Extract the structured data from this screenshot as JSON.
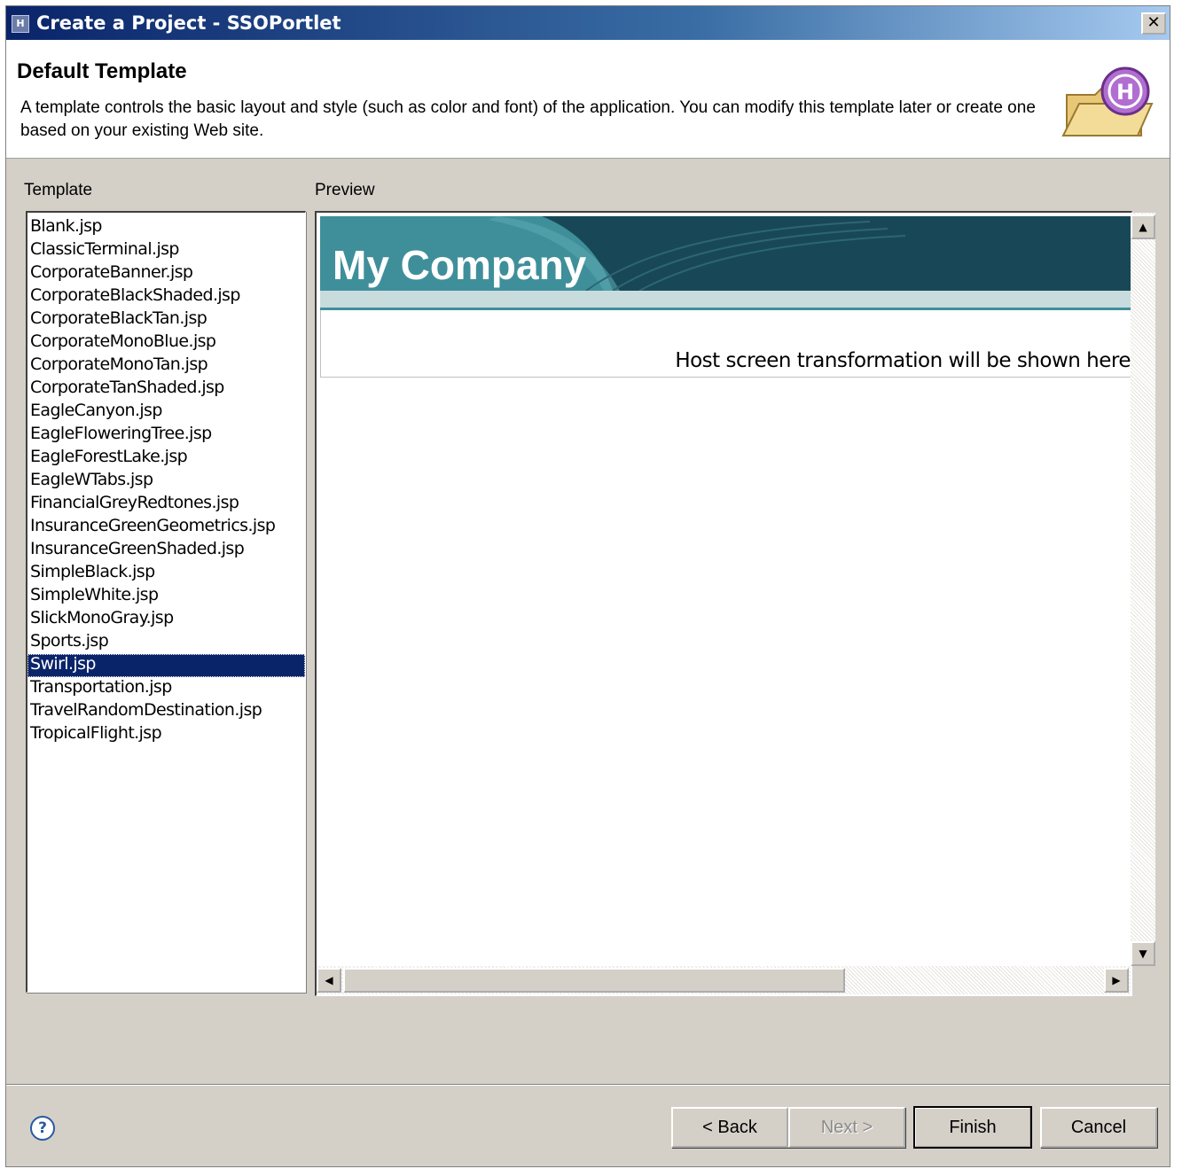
{
  "window": {
    "title": "Create a Project - SSOPortlet",
    "icon": "h-app-icon",
    "close_label": "✕"
  },
  "banner": {
    "heading": "Default Template",
    "description": "A template controls the basic layout and style (such as color and font) of the application. You can modify this template later or create one based on your existing Web site.",
    "logo_letter": "H"
  },
  "template_label": "Template",
  "preview_label": "Preview",
  "templates": [
    "Blank.jsp",
    "ClassicTerminal.jsp",
    "CorporateBanner.jsp",
    "CorporateBlackShaded.jsp",
    "CorporateBlackTan.jsp",
    "CorporateMonoBlue.jsp",
    "CorporateMonoTan.jsp",
    "CorporateTanShaded.jsp",
    "EagleCanyon.jsp",
    "EagleFloweringTree.jsp",
    "EagleForestLake.jsp",
    "EagleWTabs.jsp",
    "FinancialGreyRedtones.jsp",
    "InsuranceGreenGeometrics.jsp",
    "InsuranceGreenShaded.jsp",
    "SimpleBlack.jsp",
    "SimpleWhite.jsp",
    "SlickMonoGray.jsp",
    "Sports.jsp",
    "Swirl.jsp",
    "Transportation.jsp",
    "TravelRandomDestination.jsp",
    "TropicalFlight.jsp"
  ],
  "selected_template": "Swirl.jsp",
  "preview": {
    "company": "My Company",
    "note": "Host screen transformation will be shown here",
    "colors": {
      "header": "#184857",
      "strip": "#c8dcde",
      "accent": "#3f8f9a"
    }
  },
  "buttons": {
    "help": "?",
    "back": "< Back",
    "next": "Next >",
    "finish": "Finish",
    "cancel": "Cancel"
  },
  "scroll_glyphs": {
    "up": "▲",
    "down": "▼",
    "left": "◀",
    "right": "▶"
  }
}
